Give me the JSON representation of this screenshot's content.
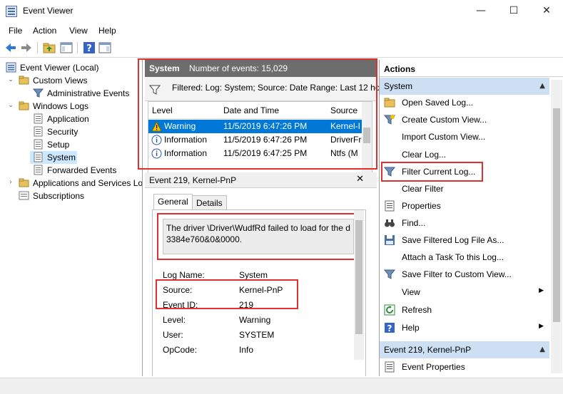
{
  "window": {
    "title": "Event Viewer",
    "minimize": "—",
    "maximize": "☐",
    "close": "✕"
  },
  "menu": [
    "File",
    "Action",
    "View",
    "Help"
  ],
  "tree": {
    "root": "Event Viewer (Local)",
    "custom_views": "Custom Views",
    "admin_events": "Administrative Events",
    "windows_logs": "Windows Logs",
    "application": "Application",
    "security": "Security",
    "setup": "Setup",
    "system": "System",
    "forwarded": "Forwarded Events",
    "app_services": "Applications and Services Lo",
    "subscriptions": "Subscriptions"
  },
  "log_header": {
    "name": "System",
    "count_text": "Number of events: 15,029"
  },
  "filter_text": "Filtered: Log: System; Source: Date Range: Last 12 hou",
  "grid": {
    "columns": [
      "Level",
      "Date and Time",
      "Source"
    ],
    "rows": [
      {
        "level": "Warning",
        "datetime": "11/5/2019 6:47:26 PM",
        "source": "Kernel-I"
      },
      {
        "level": "Information",
        "datetime": "11/5/2019 6:47:26 PM",
        "source": "DriverFr"
      },
      {
        "level": "Information",
        "datetime": "11/5/2019 6:47:25 PM",
        "source": "Ntfs (M"
      }
    ]
  },
  "detail": {
    "title": "Event 219, Kernel-PnP",
    "tabs": [
      "General",
      "Details"
    ],
    "description_line1": "The driver \\Driver\\WudfRd failed to load for the d",
    "description_line2": "3384e760&0&0000.",
    "props": {
      "log_name_label": "Log Name:",
      "log_name": "System",
      "source_label": "Source:",
      "source": "Kernel-PnP",
      "event_id_label": "Event ID:",
      "event_id": "219",
      "level_label": "Level:",
      "level": "Warning",
      "user_label": "User:",
      "user": "SYSTEM",
      "opcode_label": "OpCode:",
      "opcode": "Info"
    }
  },
  "actions": {
    "header": "Actions",
    "section1": "System",
    "items": [
      "Open Saved Log...",
      "Create Custom View...",
      "Import Custom View...",
      "Clear Log...",
      "Filter Current Log...",
      "Clear Filter",
      "Properties",
      "Find...",
      "Save Filtered Log File As...",
      "Attach a Task To this Log...",
      "Save Filter to Custom View...",
      "View",
      "Refresh",
      "Help"
    ],
    "section2": "Event 219, Kernel-PnP",
    "section2_items": [
      "Event Properties"
    ]
  },
  "colors": {
    "highlight": "#0078d7",
    "callout": "#e03030",
    "section": "#cddff3"
  }
}
